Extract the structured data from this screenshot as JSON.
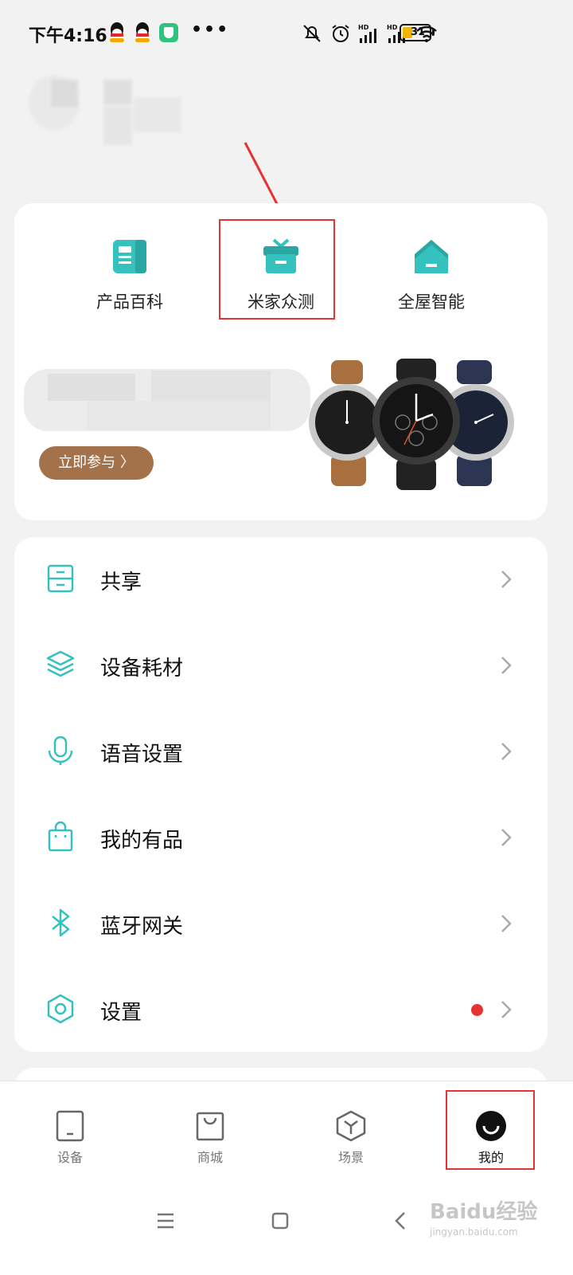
{
  "status_bar": {
    "time": "下午4:16",
    "dots": "•••",
    "battery": "31",
    "icons": [
      "qq-icon",
      "qq-icon",
      "security-shield-icon",
      "mute-icon",
      "alarm-icon",
      "hd-signal-icon",
      "hd-signal-icon",
      "wifi-icon",
      "battery-icon"
    ]
  },
  "quick_links": [
    {
      "label": "产品百科",
      "icon": "encyclopedia-icon"
    },
    {
      "label": "米家众测",
      "icon": "gift-box-icon"
    },
    {
      "label": "全屋智能",
      "icon": "smart-home-icon"
    }
  ],
  "banner": {
    "button_label": "立即参与 〉"
  },
  "menu": [
    {
      "label": "共享",
      "icon": "share-drawer-icon"
    },
    {
      "label": "设备耗材",
      "icon": "layers-icon"
    },
    {
      "label": "语音设置",
      "icon": "microphone-icon"
    },
    {
      "label": "我的有品",
      "icon": "shopping-bag-icon"
    },
    {
      "label": "蓝牙网关",
      "icon": "bluetooth-icon"
    },
    {
      "label": "设置",
      "icon": "settings-hexagon-icon"
    }
  ],
  "bottom_nav": [
    {
      "label": "设备",
      "icon": "device-tablet-icon"
    },
    {
      "label": "商城",
      "icon": "store-bag-icon"
    },
    {
      "label": "场景",
      "icon": "scene-cube-icon"
    },
    {
      "label": "我的",
      "icon": "profile-avatar-icon",
      "active": true
    }
  ],
  "watermark": {
    "main": "Baidu经验",
    "sub": "jingyan.baidu.com"
  },
  "colors": {
    "accent": "#35c2bf",
    "highlight_red": "#e53232",
    "join_button": "#a3714a"
  }
}
